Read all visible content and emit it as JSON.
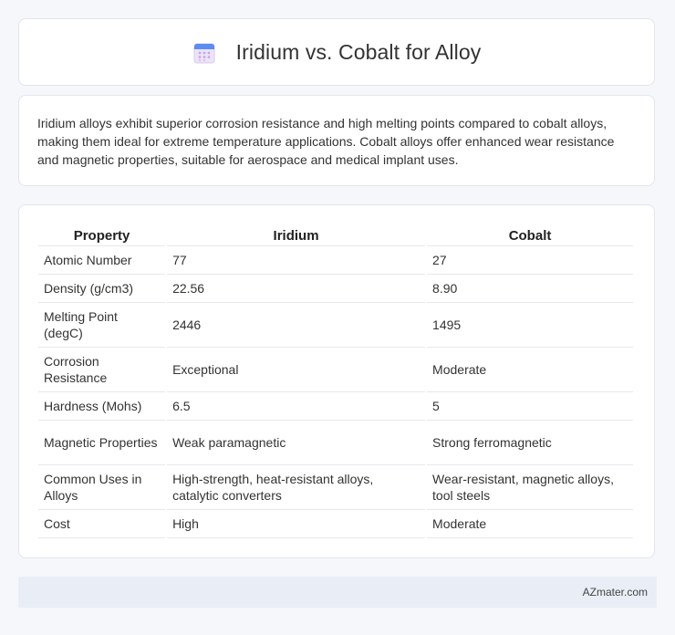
{
  "header": {
    "title": "Iridium vs. Cobalt for Alloy",
    "icon": "calendar-icon"
  },
  "description": "Iridium alloys exhibit superior corrosion resistance and high melting points compared to cobalt alloys, making them ideal for extreme temperature applications. Cobalt alloys offer enhanced wear resistance and magnetic properties, suitable for aerospace and medical implant uses.",
  "table": {
    "headers": [
      "Property",
      "Iridium",
      "Cobalt"
    ],
    "rows": [
      [
        "Atomic Number",
        "77",
        "27"
      ],
      [
        "Density (g/cm3)",
        "22.56",
        "8.90"
      ],
      [
        "Melting Point (degC)",
        "2446",
        "1495"
      ],
      [
        "Corrosion Resistance",
        "Exceptional",
        "Moderate"
      ],
      [
        "Hardness (Mohs)",
        "6.5",
        "5"
      ],
      [
        "Magnetic Properties",
        "Weak paramagnetic",
        "Strong ferromagnetic"
      ],
      [
        "Common Uses in Alloys",
        "High-strength, heat-resistant alloys, catalytic converters",
        "Wear-resistant, magnetic alloys, tool steels"
      ],
      [
        "Cost",
        "High",
        "Moderate"
      ]
    ]
  },
  "footer": {
    "brand": "AZmater.com"
  },
  "colors": {
    "background": "#f5f7fa",
    "card": "#ffffff",
    "footer": "#e9eef6",
    "icon_top": "#5b8def",
    "icon_body": "#e8ddf5"
  }
}
